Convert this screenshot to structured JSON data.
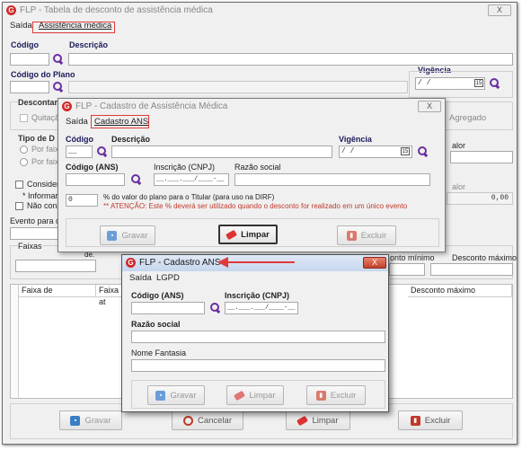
{
  "main": {
    "title": "FLP - Tabela de desconto de assistência médica",
    "close": "X",
    "menu": {
      "saida": "Saída",
      "assistencia": "Assistência médica"
    },
    "codigo_label": "Código",
    "descricao_label": "Descrição",
    "codigo_plano_label": "Código do Plano",
    "vigencia_label": "Vigência",
    "vigencia_value": "/ /",
    "descontar_label": "Descontar",
    "quitacao_label": "Quitação",
    "agregado_label": "Agregado",
    "tipo_label": "Tipo de D",
    "por_faixa1": "Por faixa",
    "por_faixa2": "Por faixa",
    "considerar_label": "Considera",
    "informar_label": "* Informar",
    "nao_cons_label": "Não cons",
    "evento_label": "Evento para de",
    "faixas_label": "Faixas",
    "de_label": "de.",
    "valor_label": "alor",
    "valor2_label": "alor",
    "valor_value": "0,00",
    "desconto_minimo_label": "onto mínimo",
    "desconto_maximo_label": "Desconto máximo",
    "grid_headers": {
      "faixa_de": "Faixa de",
      "faixa_ate": "Faixa at",
      "desconto_maximo": "Desconto máximo"
    },
    "buttons": {
      "gravar": "Gravar",
      "cancelar": "Cancelar",
      "limpar": "Limpar",
      "excluir": "Excluir"
    }
  },
  "mid": {
    "title": "FLP - Cadastro de Assistência Médica",
    "close": "X",
    "menu": {
      "saida": "Saída",
      "cadastro": "Cadastro ANS"
    },
    "codigo_label": "Código",
    "descricao_label": "Descrição",
    "vigencia_label": "Vigência",
    "vigencia_value": "/ /",
    "codigo_ans_label": "Código (ANS)",
    "inscricao_label": "Inscrição (CNPJ)",
    "inscricao_value": "__.___.___/____-__",
    "razao_label": "Razão social",
    "percent_value": "0",
    "percent_text": "% do valor do plano para o Titular (para uso na DIRF)",
    "atencao_text": "** ATENÇÃO: Este % deverá ser utilizado quando o desconto for realizado em um único evento",
    "buttons": {
      "gravar": "Gravar",
      "limpar": "Limpar",
      "excluir": "Excluir"
    }
  },
  "top": {
    "title": "FLP - Cadastro ANS",
    "close": "X",
    "menu": {
      "saida": "Saída",
      "lgpd": "LGPD"
    },
    "codigo_ans_label": "Código (ANS)",
    "inscricao_label": "Inscrição (CNPJ)",
    "inscricao_value": "__.___.___/____-__",
    "razao_label": "Razão social",
    "nome_fantasia_label": "Nome Fantasia",
    "buttons": {
      "gravar": "Gravar",
      "limpar": "Limpar",
      "excluir": "Excluir"
    }
  },
  "colors": {
    "annotation": "#e03a3a",
    "label_blue": "#1a1a5c",
    "search_purple": "#6a2fa0"
  }
}
